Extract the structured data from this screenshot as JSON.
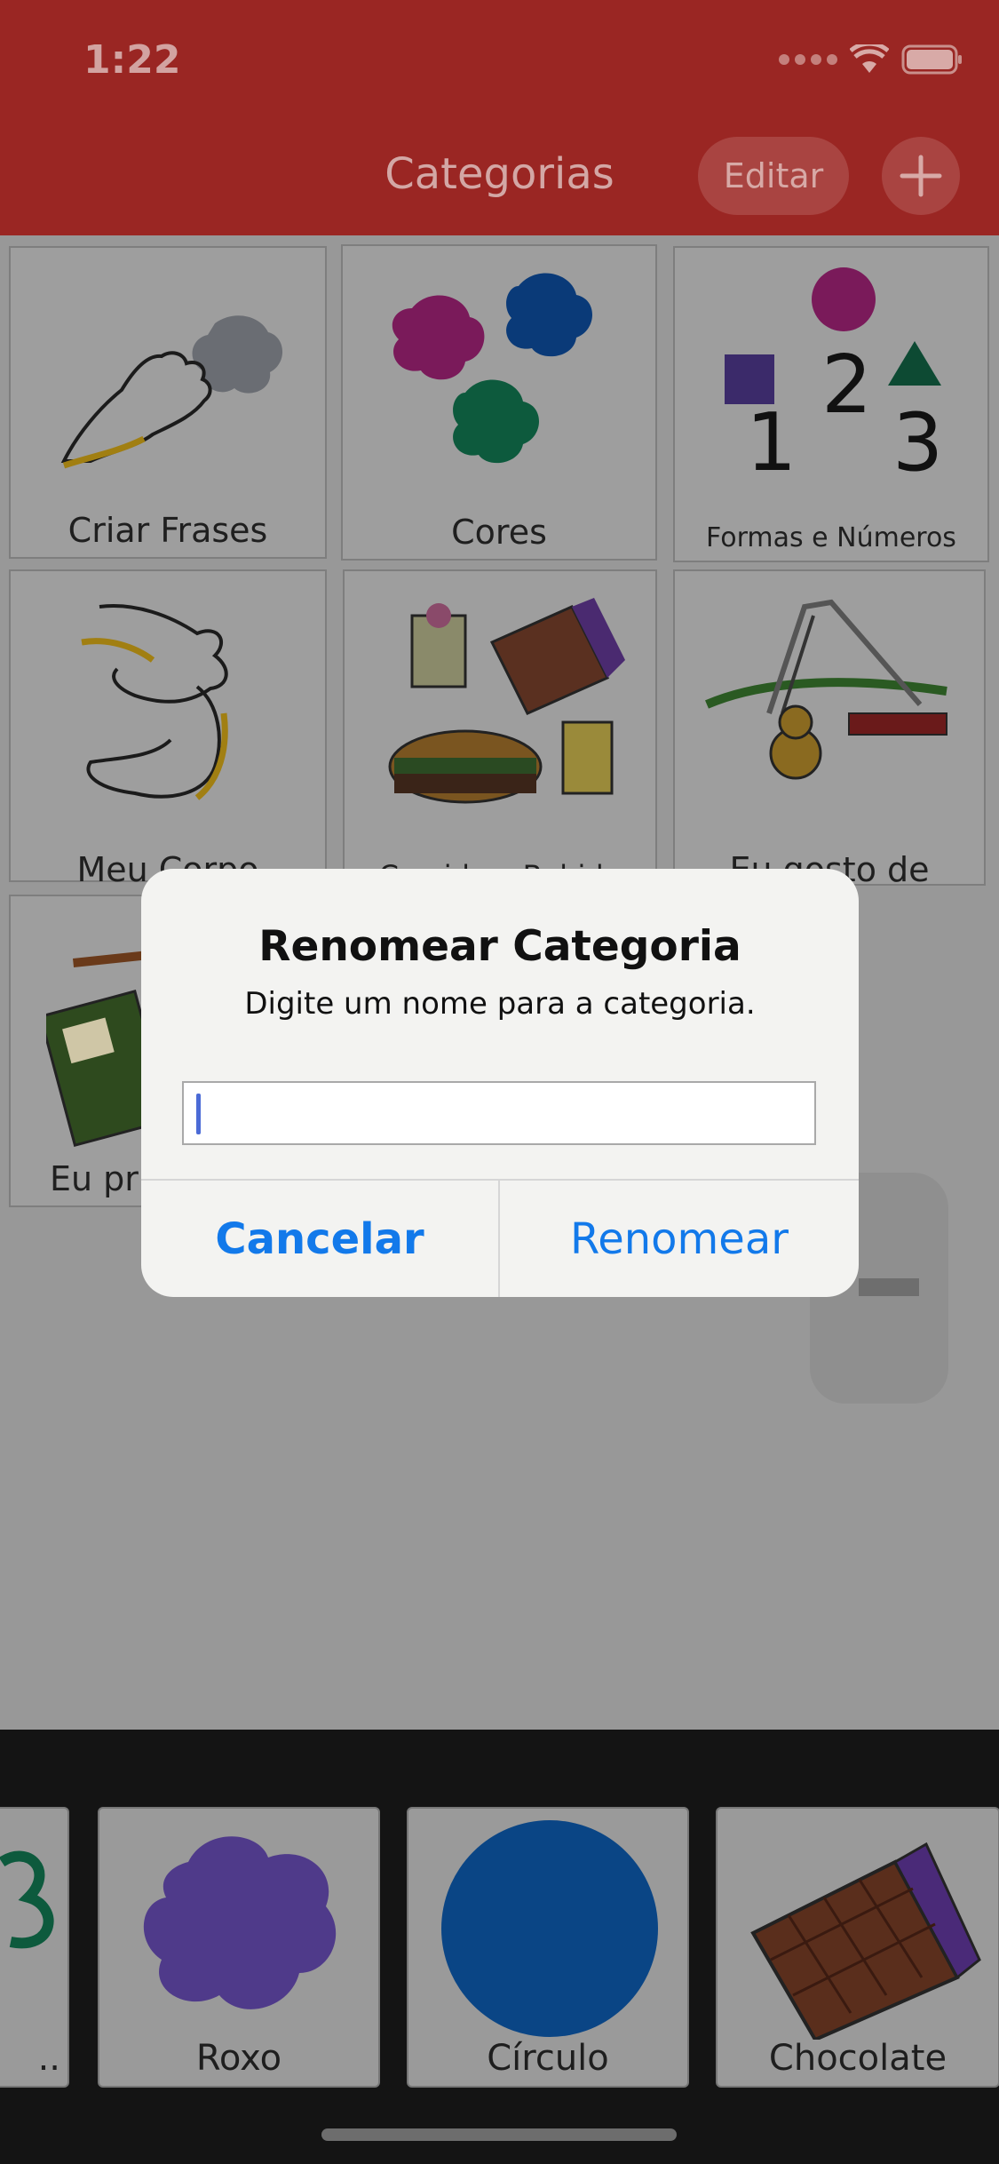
{
  "status_bar": {
    "time": "1:22"
  },
  "nav": {
    "title": "Categorias",
    "edit_label": "Editar",
    "add_icon": "plus-icon"
  },
  "grid": {
    "tiles": [
      {
        "label": "Criar Frases",
        "icon": "hand-stone-icon"
      },
      {
        "label": "Cores",
        "icon": "color-blobs-icon"
      },
      {
        "label": "Formas e Números",
        "icon": "shapes-numbers-icon"
      },
      {
        "label": "Meu Corpo",
        "icon": "hand-foot-icon"
      },
      {
        "label": "Comida e Bebida",
        "icon": "food-drink-icon"
      },
      {
        "label": "Eu gosto de",
        "icon": "playground-icon"
      },
      {
        "label": "Eu pr",
        "icon": "notebook-icon"
      }
    ]
  },
  "dialog": {
    "title": "Renomear Categoria",
    "message": "Digite um nome para a categoria.",
    "input_value": "",
    "cancel_label": "Cancelar",
    "rename_label": "Renomear"
  },
  "bottom_bar": {
    "items": [
      {
        "label": "..",
        "icon": "number-3-icon"
      },
      {
        "label": "Roxo",
        "icon": "purple-blob-icon"
      },
      {
        "label": "Círculo",
        "icon": "blue-circle-icon"
      },
      {
        "label": "Chocolate",
        "icon": "chocolate-icon"
      }
    ]
  },
  "colors": {
    "header": "#9a2623",
    "overlay": "#989898",
    "dialog_button": "#1279ea",
    "purple": "#4f3a8a",
    "blue": "#0a4585"
  }
}
